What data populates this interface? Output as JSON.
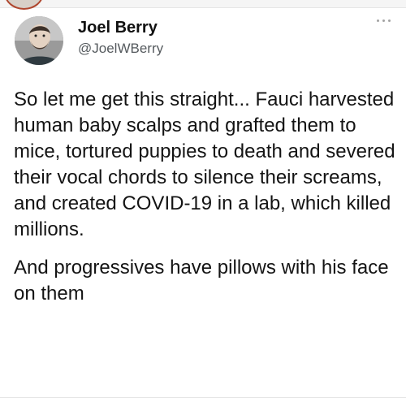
{
  "author": {
    "display_name": "Joel Berry",
    "handle": "@JoelWBerry"
  },
  "tweet": {
    "paragraph_1": "So let me get this straight... Fauci harvested human baby scalps and grafted them to mice, tortured puppies to death and severed their vocal chords to silence their screams, and created COVID-19 in a lab, which killed millions.",
    "paragraph_2": "And progressives have pillows with his face on them"
  },
  "icons": {
    "more": "more-options-icon",
    "avatar": "profile-photo"
  }
}
